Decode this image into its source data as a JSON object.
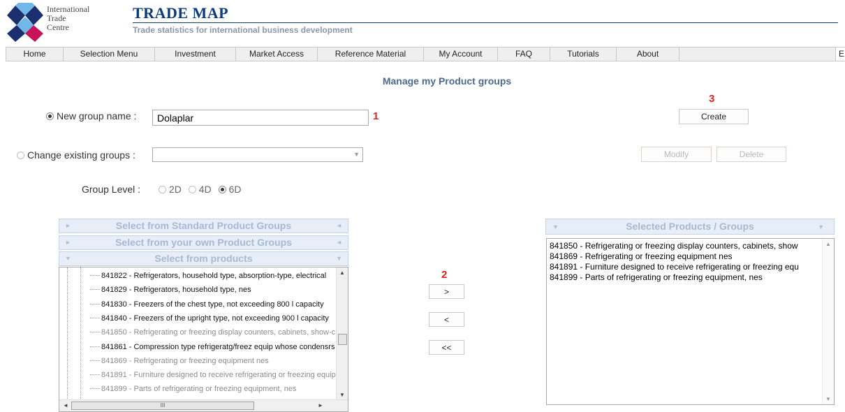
{
  "header": {
    "logo_lines": [
      "International",
      "Trade",
      "Centre"
    ],
    "brand_title": "TRADE MAP",
    "brand_subtitle": "Trade statistics for international business development"
  },
  "nav": {
    "items": [
      "Home",
      "Selection Menu",
      "Investment",
      "Market Access",
      "Reference Material",
      "My Account",
      "FAQ",
      "Tutorials",
      "About"
    ],
    "lang": "E"
  },
  "page_title": "Manage my Product groups",
  "new_group": {
    "label": "New group name :",
    "value": "Dolaplar",
    "selected": true
  },
  "change_existing": {
    "label": "Change existing groups :",
    "value": ""
  },
  "group_level": {
    "label": "Group Level :",
    "options": [
      "2D",
      "4D",
      "6D"
    ],
    "selected": "6D"
  },
  "buttons": {
    "create": "Create",
    "modify": "Modify",
    "delete": "Delete",
    "add": ">",
    "remove": "<",
    "remove_all": "<<"
  },
  "annotations": {
    "step1": "1",
    "step2": "2",
    "step3": "3"
  },
  "left_panel": {
    "sections": [
      "Select from Standard Product Groups",
      "Select from your own Product Groups",
      "Select from products"
    ],
    "products": [
      {
        "text": "841822 - Refrigerators, household type, absorption-type, electrical",
        "disabled": false
      },
      {
        "text": "841829 - Refrigerators, household type, nes",
        "disabled": false
      },
      {
        "text": "841830 - Freezers of the chest type, not exceeding 800 l capacity",
        "disabled": false
      },
      {
        "text": "841840 - Freezers of the upright type, not exceeding 900 l capacity",
        "disabled": false
      },
      {
        "text": "841850 - Refrigerating or freezing display counters, cabinets, show-c",
        "disabled": true
      },
      {
        "text": "841861 - Compression type refrigeratg/freez equip whose condensrs",
        "disabled": false
      },
      {
        "text": "841869 - Refrigerating or freezing equipment nes",
        "disabled": true
      },
      {
        "text": "841891 - Furniture designed to receive refrigerating or freezing equip",
        "disabled": true
      },
      {
        "text": "841899 - Parts of refrigerating or freezing equipment, nes",
        "disabled": true
      }
    ],
    "hscroll_thumb": "III"
  },
  "right_panel": {
    "title": "Selected Products / Groups",
    "items": [
      "841850 - Refrigerating or freezing display counters, cabinets, show",
      "841869 - Refrigerating or freezing equipment nes",
      "841891 - Furniture designed to receive refrigerating or freezing equ",
      "841899 - Parts of refrigerating or freezing equipment, nes"
    ]
  }
}
